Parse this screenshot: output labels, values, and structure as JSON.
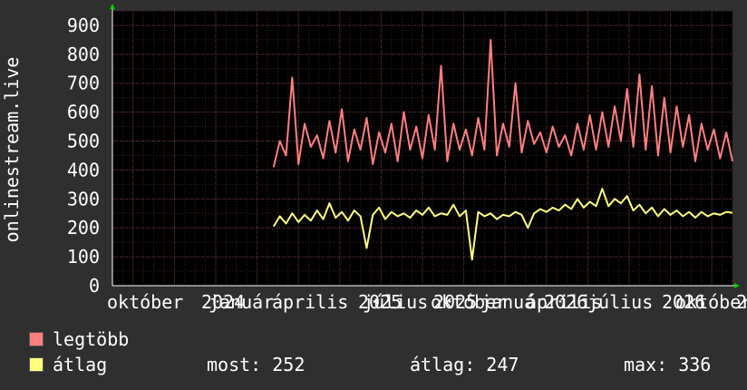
{
  "chart_data": {
    "type": "line",
    "ylabel": "onlinestream.live",
    "ylim": [
      0,
      950
    ],
    "yticks": [
      0,
      100,
      200,
      300,
      400,
      500,
      600,
      700,
      800,
      900
    ],
    "xticks": [
      "október",
      "2024",
      "január",
      "április",
      "2025",
      "július",
      "október",
      "2025",
      "január",
      "április",
      "2026",
      "július",
      "2026",
      "október",
      "2"
    ],
    "grid": true,
    "background": "#000000",
    "colors": {
      "max_series": "#ff7f7f",
      "avg_series": "#ffff7f",
      "grid": "#5a2f2f",
      "axis": "#ffffff",
      "arrow": "#00cc00"
    },
    "series": [
      {
        "name": "legtöbb",
        "color": "#ff7f7f",
        "x": [
          0.26,
          0.27,
          0.28,
          0.29,
          0.3,
          0.31,
          0.32,
          0.33,
          0.34,
          0.35,
          0.36,
          0.37,
          0.38,
          0.39,
          0.4,
          0.41,
          0.42,
          0.43,
          0.44,
          0.45,
          0.46,
          0.47,
          0.48,
          0.49,
          0.5,
          0.51,
          0.52,
          0.53,
          0.54,
          0.55,
          0.56,
          0.57,
          0.58,
          0.59,
          0.6,
          0.61,
          0.62,
          0.63,
          0.64,
          0.65,
          0.66,
          0.67,
          0.68,
          0.69,
          0.7,
          0.71,
          0.72,
          0.73,
          0.74,
          0.75,
          0.76,
          0.77,
          0.78,
          0.79,
          0.8,
          0.81,
          0.82,
          0.83,
          0.84,
          0.85,
          0.86,
          0.87,
          0.88,
          0.89,
          0.9,
          0.91,
          0.92,
          0.93,
          0.94,
          0.95,
          0.96,
          0.97,
          0.98,
          0.99,
          1.0
        ],
        "values": [
          410,
          500,
          450,
          720,
          420,
          560,
          480,
          520,
          440,
          570,
          460,
          610,
          430,
          540,
          470,
          580,
          420,
          530,
          460,
          560,
          430,
          600,
          470,
          550,
          440,
          590,
          470,
          760,
          430,
          560,
          470,
          540,
          450,
          580,
          470,
          850,
          450,
          560,
          480,
          700,
          460,
          570,
          490,
          530,
          460,
          550,
          480,
          520,
          450,
          560,
          470,
          590,
          470,
          600,
          480,
          620,
          500,
          680,
          480,
          730,
          470,
          690,
          450,
          650,
          460,
          620,
          480,
          590,
          430,
          560,
          470,
          540,
          440,
          530,
          430
        ]
      },
      {
        "name": "átlag",
        "color": "#ffff7f",
        "x": [
          0.26,
          0.27,
          0.28,
          0.29,
          0.3,
          0.31,
          0.32,
          0.33,
          0.34,
          0.35,
          0.36,
          0.37,
          0.38,
          0.39,
          0.4,
          0.41,
          0.42,
          0.43,
          0.44,
          0.45,
          0.46,
          0.47,
          0.48,
          0.49,
          0.5,
          0.51,
          0.52,
          0.53,
          0.54,
          0.55,
          0.56,
          0.57,
          0.58,
          0.59,
          0.6,
          0.61,
          0.62,
          0.63,
          0.64,
          0.65,
          0.66,
          0.67,
          0.68,
          0.69,
          0.7,
          0.71,
          0.72,
          0.73,
          0.74,
          0.75,
          0.76,
          0.77,
          0.78,
          0.79,
          0.8,
          0.81,
          0.82,
          0.83,
          0.84,
          0.85,
          0.86,
          0.87,
          0.88,
          0.89,
          0.9,
          0.91,
          0.92,
          0.93,
          0.94,
          0.95,
          0.96,
          0.97,
          0.98,
          0.99,
          1.0
        ],
        "values": [
          205,
          240,
          215,
          250,
          220,
          245,
          225,
          260,
          230,
          285,
          235,
          255,
          225,
          260,
          240,
          130,
          245,
          270,
          230,
          255,
          240,
          250,
          235,
          260,
          245,
          270,
          240,
          250,
          245,
          280,
          240,
          260,
          90,
          255,
          240,
          250,
          230,
          245,
          240,
          255,
          245,
          200,
          250,
          265,
          255,
          270,
          260,
          280,
          265,
          300,
          270,
          290,
          275,
          335,
          275,
          300,
          285,
          310,
          260,
          280,
          250,
          270,
          240,
          265,
          245,
          260,
          240,
          255,
          235,
          255,
          240,
          250,
          245,
          255,
          252
        ]
      }
    ]
  },
  "legend": [
    {
      "label": "legtöbb",
      "color": "#ff7f7f"
    },
    {
      "label": "átlag",
      "color": "#ffff7f"
    }
  ],
  "stats": {
    "most": "most: 252",
    "atlag": "átlag: 247",
    "max": "max: 336"
  }
}
